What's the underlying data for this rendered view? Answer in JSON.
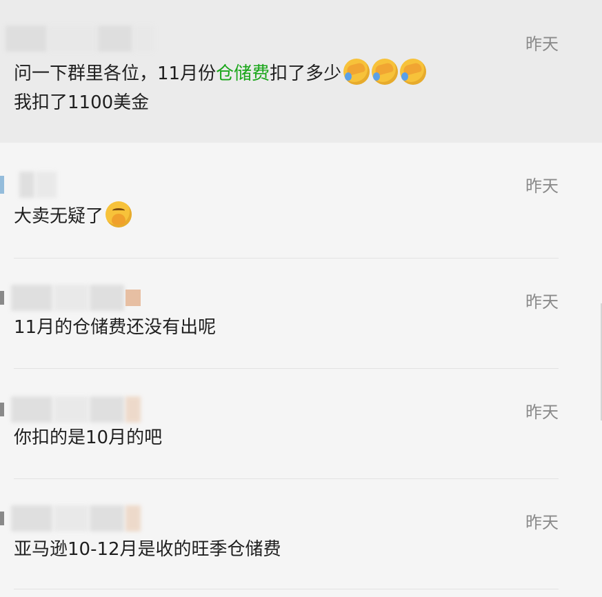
{
  "messages": [
    {
      "time": "昨天",
      "line1_before": "问一下群里各位，11月份",
      "line1_highlight": "仓储费",
      "line1_after": "扣了多少",
      "line1_emojis": [
        "facepalm-emoji",
        "facepalm-emoji",
        "facepalm-emoji"
      ],
      "line2": "我扣了1100美金"
    },
    {
      "time": "昨天",
      "text": "大卖无疑了",
      "emoji": "thinking-hand-over-mouth-emoji"
    },
    {
      "time": "昨天",
      "text": "11月的仓储费还没有出呢"
    },
    {
      "time": "昨天",
      "text": "你扣的是10月的吧"
    },
    {
      "time": "昨天",
      "text": "亚马逊10-12月是收的旺季仓储费"
    }
  ],
  "colors": {
    "highlight_text": "#1aa61a",
    "background": "#f5f5f5",
    "highlight_row": "#ebebeb",
    "timestamp": "#8a8a8a"
  }
}
